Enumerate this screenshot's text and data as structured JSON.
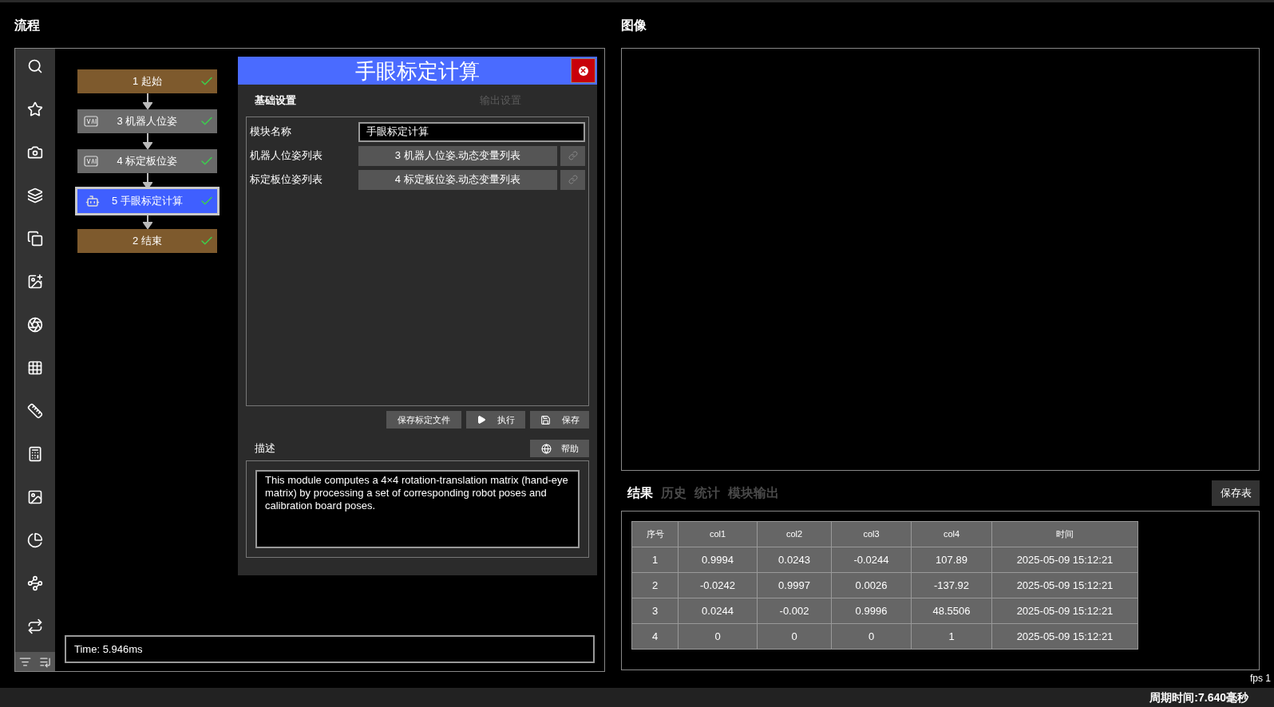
{
  "flow_panel": {
    "title": "流程",
    "nodes": [
      {
        "label": "1 起始",
        "kind": "start",
        "selected": false,
        "done": true
      },
      {
        "label": "3 机器人位姿",
        "kind": "var",
        "selected": false,
        "done": true
      },
      {
        "label": "4 标定板位姿",
        "kind": "var",
        "selected": false,
        "done": true
      },
      {
        "label": "5 手眼标定计算",
        "kind": "calc",
        "selected": true,
        "done": true
      },
      {
        "label": "2 结束",
        "kind": "end",
        "selected": false,
        "done": true
      }
    ],
    "time": "Time: 5.946ms"
  },
  "dialog": {
    "title": "手眼标定计算",
    "tabs": [
      {
        "label": "基础设置",
        "selected": true
      },
      {
        "label": "输出设置",
        "selected": false
      }
    ],
    "fields": [
      {
        "label": "模块名称",
        "kind": "text",
        "value": "手眼标定计算"
      },
      {
        "label": "机器人位姿列表",
        "kind": "link",
        "value": "3 机器人位姿.动态变量列表"
      },
      {
        "label": "标定板位姿列表",
        "kind": "link",
        "value": "4 标定板位姿.动态变量列表"
      }
    ],
    "buttons": [
      {
        "label": "保存标定文件",
        "kind": "plain"
      },
      {
        "label": "执行",
        "kind": "run"
      },
      {
        "label": "保存",
        "kind": "save"
      }
    ],
    "description_title": "描述",
    "help_button": "帮助",
    "description": "This module computes a 4×4 rotation-translation matrix (hand-eye matrix) by processing a set of corresponding robot poses and calibration board poses."
  },
  "image_panel": {
    "title": "图像"
  },
  "results": {
    "tabs": [
      {
        "label": "结果",
        "selected": true
      },
      {
        "label": "历史",
        "selected": false
      },
      {
        "label": "统计",
        "selected": false
      },
      {
        "label": "模块输出",
        "selected": false
      }
    ],
    "save_button": "保存表",
    "table": {
      "columns": [
        "序号",
        "col1",
        "col2",
        "col3",
        "col4",
        "时间"
      ],
      "rows": [
        [
          "1",
          "0.9994",
          "0.0243",
          "-0.0244",
          "107.89",
          "2025-05-09 15:12:21"
        ],
        [
          "2",
          "-0.0242",
          "0.9997",
          "0.0026",
          "-137.92",
          "2025-05-09 15:12:21"
        ],
        [
          "3",
          "0.0244",
          "-0.002",
          "0.9996",
          "48.5506",
          "2025-05-09 15:12:21"
        ],
        [
          "4",
          "0",
          "0",
          "0",
          "1",
          "2025-05-09 15:12:21"
        ]
      ]
    },
    "fps": "fps 1"
  },
  "status_bar": {
    "cycle_time": "周期时间:7.640毫秒"
  }
}
